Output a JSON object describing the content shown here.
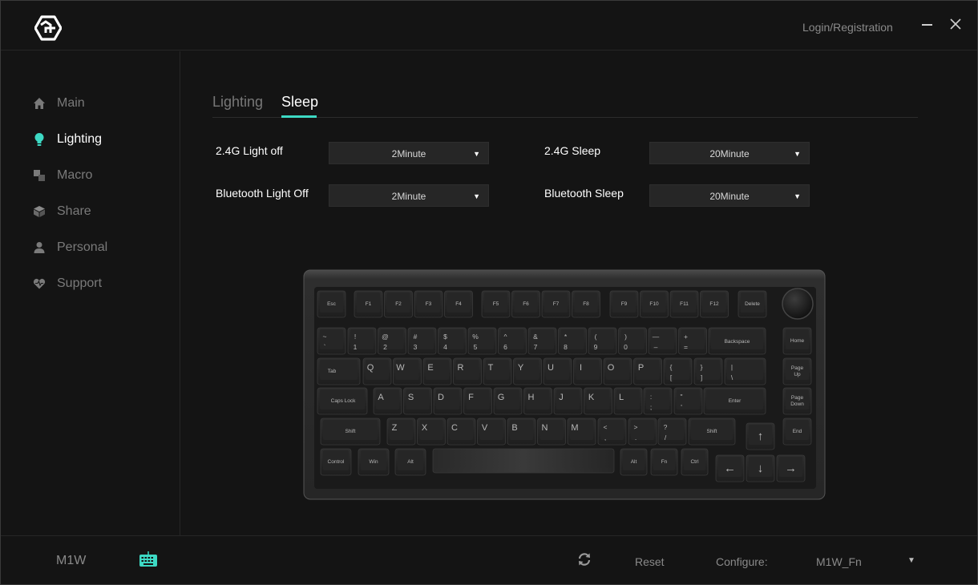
{
  "titlebar": {
    "login_label": "Login/Registration"
  },
  "sidebar": {
    "items": [
      {
        "label": "Main",
        "icon": "home-icon",
        "active": false
      },
      {
        "label": "Lighting",
        "icon": "bulb-icon",
        "active": true
      },
      {
        "label": "Macro",
        "icon": "macro-icon",
        "active": false
      },
      {
        "label": "Share",
        "icon": "cube-icon",
        "active": false
      },
      {
        "label": "Personal",
        "icon": "user-icon",
        "active": false
      },
      {
        "label": "Support",
        "icon": "heart-icon",
        "active": false
      }
    ]
  },
  "tabs": [
    {
      "label": "Lighting",
      "active": false
    },
    {
      "label": "Sleep",
      "active": true
    }
  ],
  "settings": {
    "light_off_24g": {
      "label": "2.4G Light off",
      "value": "2Minute"
    },
    "sleep_24g": {
      "label": "2.4G Sleep",
      "value": "20Minute"
    },
    "light_off_bt": {
      "label": "Bluetooth Light Off",
      "value": "2Minute"
    },
    "sleep_bt": {
      "label": "Bluetooth Sleep",
      "value": "20Minute"
    }
  },
  "keyboard": {
    "keys": {
      "esc": "Esc",
      "f1": "F1",
      "f2": "F2",
      "f3": "F3",
      "f4": "F4",
      "f5": "F5",
      "f6": "F6",
      "f7": "F7",
      "f8": "F8",
      "f9": "F9",
      "f10": "F10",
      "f11": "F11",
      "f12": "F12",
      "delete": "Delete",
      "tilde": "~",
      "backtick": "`",
      "n1_top": "!",
      "n1": "1",
      "n2_top": "@",
      "n2": "2",
      "n3_top": "#",
      "n3": "3",
      "n4_top": "$",
      "n4": "4",
      "n5_top": "%",
      "n5": "5",
      "n6_top": "^",
      "n6": "6",
      "n7_top": "&",
      "n7": "7",
      "n8_top": "*",
      "n8": "8",
      "n9_top": "(",
      "n9": "9",
      "n0_top": ")",
      "n0": "0",
      "minus_top": "—",
      "minus": "–",
      "plus_top": "+",
      "plus": "=",
      "backspace": "Backspace",
      "home": "Home",
      "tab": "Tab",
      "q": "Q",
      "w": "W",
      "e": "E",
      "r": "R",
      "t": "T",
      "y": "Y",
      "u": "U",
      "i": "I",
      "o": "O",
      "p": "P",
      "lbrace": "{",
      "lbracket": "[",
      "rbrace": "}",
      "rbracket": "]",
      "pipe": "|",
      "backslash": "\\",
      "page_up_1": "Page",
      "page_up_2": "Up",
      "caps": "Caps Lock",
      "a": "A",
      "s": "S",
      "d": "D",
      "f": "F",
      "g": "G",
      "h": "H",
      "j": "J",
      "k": "K",
      "l": "L",
      "colon": ":",
      "semicolon": ";",
      "quote_top": "\"",
      "quote": "'",
      "enter": "Enter",
      "page_down_1": "Page",
      "page_down_2": "Down",
      "lshift": "Shift",
      "z": "Z",
      "x": "X",
      "c": "C",
      "v": "V",
      "b": "B",
      "n": "N",
      "m": "M",
      "lt": "<",
      "comma": ",",
      "gt": ">",
      "period": ".",
      "question": "?",
      "slash": "/",
      "rshift": "Shift",
      "up": "↑",
      "end": "End",
      "ctrl": "Control",
      "win": "Win",
      "alt": "Alt",
      "ralt": "Alt",
      "fn": "Fn",
      "rctrl": "Ctrl",
      "left": "←",
      "down": "↓",
      "right": "→"
    }
  },
  "footer": {
    "device_name": "M1W",
    "reset_label": "Reset",
    "configure_label": "Configure:",
    "configure_value": "M1W_Fn"
  },
  "colors": {
    "accent": "#3dd9c4",
    "background": "#141414"
  }
}
